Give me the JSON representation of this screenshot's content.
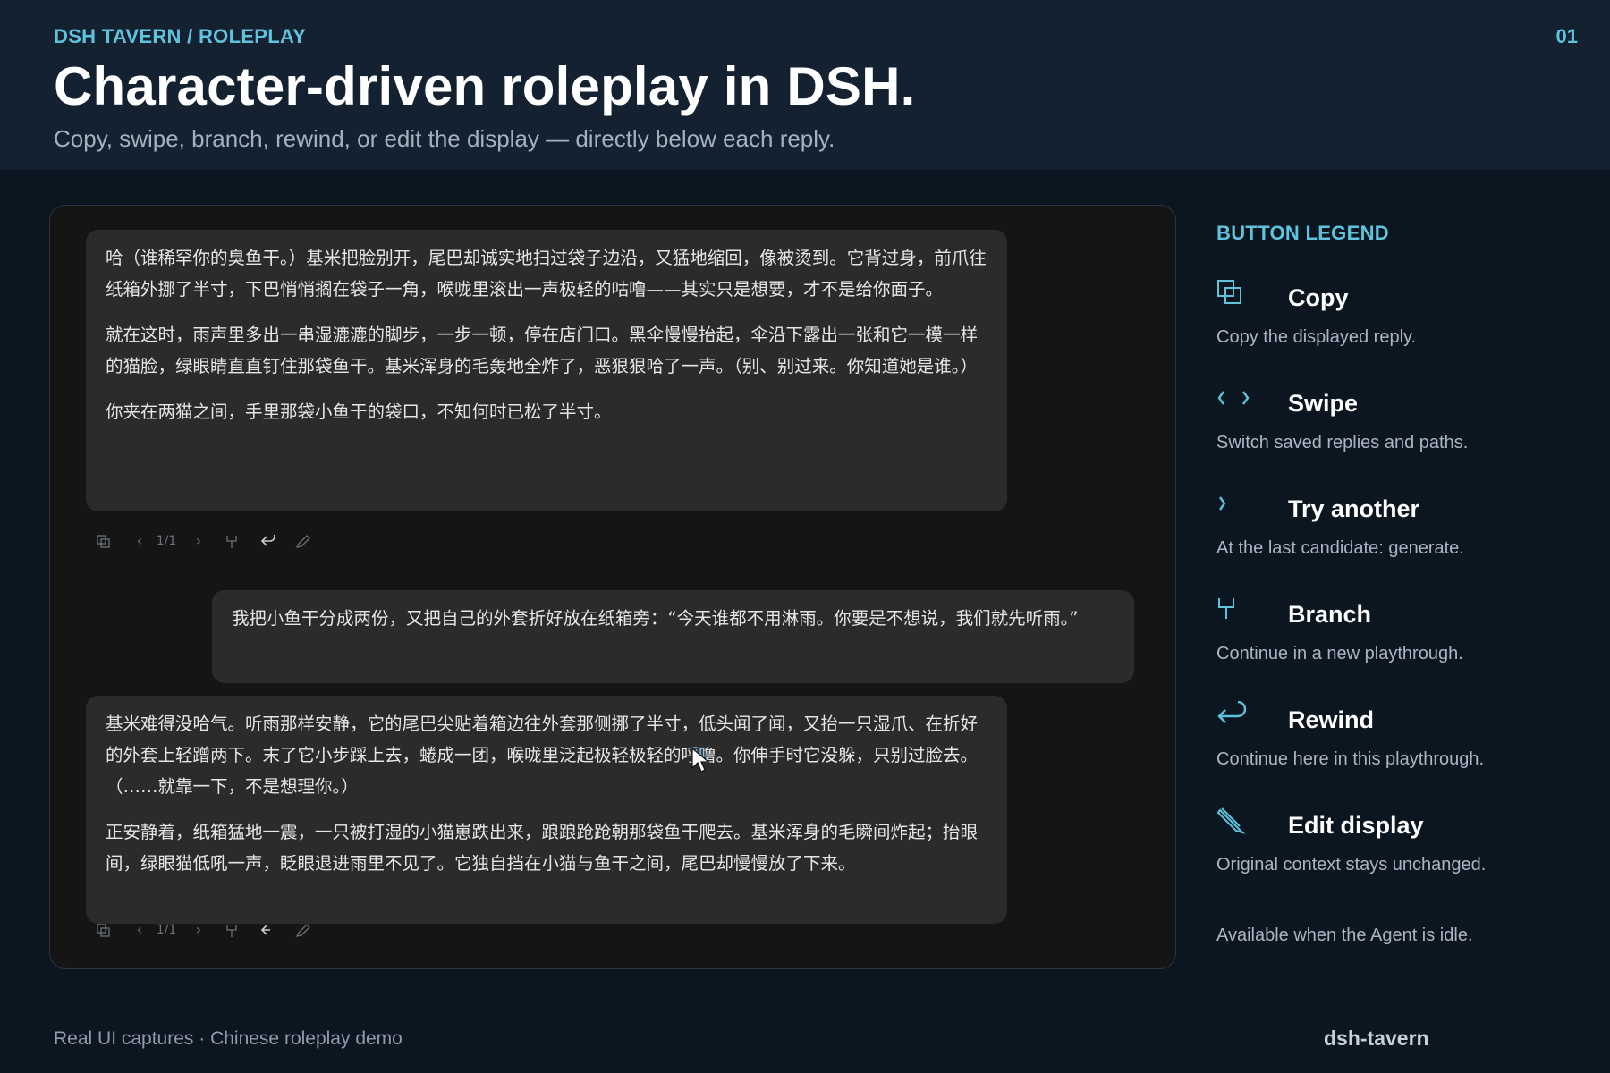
{
  "header": {
    "eyebrow": "DSH TAVERN / ROLEPLAY",
    "page_number": "01",
    "title": "Character-driven roleplay in DSH.",
    "subtitle": "Copy, swipe, branch, rewind, or edit the display — directly below each reply."
  },
  "chat": {
    "messages": [
      {
        "role": "character",
        "paragraphs": [
          "哈（谁稀罕你的臭鱼干。）基米把脸别开，尾巴却诚实地扫过袋子边沿，又猛地缩回，像被烫到。它背过身，前爪往纸箱外挪了半寸，下巴悄悄搁在袋子一角，喉咙里滚出一声极轻的咕噜——其实只是想要，才不是给你面子。",
          "就在这时，雨声里多出一串湿漉漉的脚步，一步一顿，停在店门口。黑伞慢慢抬起，伞沿下露出一张和它一模一样的猫脸，绿眼睛直直钉住那袋鱼干。基米浑身的毛轰地全炸了，恶狠狠哈了一声。（别、别过来。你知道她是谁。）",
          "你夹在两猫之间，手里那袋小鱼干的袋口，不知何时已松了半寸。"
        ],
        "counter": "1/1"
      },
      {
        "role": "user",
        "paragraphs": [
          "我把小鱼干分成两份，又把自己的外套折好放在纸箱旁：“今天谁都不用淋雨。你要是不想说，我们就先听雨。”"
        ]
      },
      {
        "role": "character",
        "paragraphs": [
          "基米难得没哈气。听雨那样安静，它的尾巴尖贴着箱边往外套那侧挪了半寸，低头闻了闻，又抬一只湿爪、在折好的外套上轻蹭两下。末了它小步踩上去，蜷成一团，喉咙里泛起极轻极轻的呼噜。你伸手时它没躲，只别过脸去。（……就靠一下，不是想理你。）",
          "正安静着，纸箱猛地一震，一只被打湿的小猫崽跌出来，踉踉跄跄朝那袋鱼干爬去。基米浑身的毛瞬间炸起；抬眼间，绿眼猫低吼一声，眨眼退进雨里不见了。它独自挡在小猫与鱼干之间，尾巴却慢慢放了下来。"
        ],
        "counter": "1/1"
      }
    ],
    "action_icons": [
      "copy-icon",
      "chevron-left-icon",
      "chevron-right-icon",
      "branch-icon",
      "rewind-icon",
      "pencil-icon"
    ]
  },
  "legend": {
    "title": "BUTTON LEGEND",
    "items": [
      {
        "icon": "copy-icon",
        "label": "Copy",
        "desc": "Copy the displayed reply."
      },
      {
        "icon": "swipe-icon",
        "label": "Swipe",
        "desc": "Switch saved replies and paths."
      },
      {
        "icon": "chevron-right-icon",
        "label": "Try another",
        "desc": "At the last candidate: generate."
      },
      {
        "icon": "branch-icon",
        "label": "Branch",
        "desc": "Continue in a new playthrough."
      },
      {
        "icon": "rewind-icon",
        "label": "Rewind",
        "desc": "Continue here in this playthrough."
      },
      {
        "icon": "pencil-icon",
        "label": "Edit display",
        "desc": "Original context stays unchanged."
      }
    ],
    "note": "Available when the Agent is idle."
  },
  "footer": {
    "left": "Real UI captures · Chinese roleplay demo",
    "right": "dsh-tavern"
  },
  "colors": {
    "accent": "#5fc3dc",
    "background": "#0c1621",
    "header_bg": "#132131",
    "panel_bg": "#151515",
    "bubble_bg": "#2b2b2b"
  }
}
